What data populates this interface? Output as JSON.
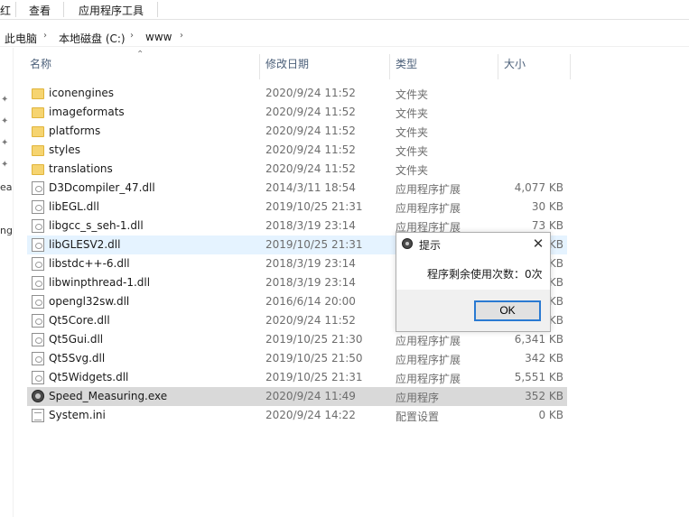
{
  "ribbon": {
    "tab_fragment": "红",
    "tab_view": "查看",
    "tab_app_tools": "应用程序工具"
  },
  "breadcrumb": [
    "此电脑",
    "本地磁盘 (C:)",
    "www"
  ],
  "nav_fragments": {
    "a": "ea",
    "b": "ng"
  },
  "columns": {
    "name": "名称",
    "date": "修改日期",
    "type": "类型",
    "size": "大小"
  },
  "files": [
    {
      "name": "iconengines",
      "date": "2020/9/24 11:52",
      "type": "文件夹",
      "size": "",
      "icon": "folder-icon"
    },
    {
      "name": "imageformats",
      "date": "2020/9/24 11:52",
      "type": "文件夹",
      "size": "",
      "icon": "folder-icon"
    },
    {
      "name": "platforms",
      "date": "2020/9/24 11:52",
      "type": "文件夹",
      "size": "",
      "icon": "folder-icon"
    },
    {
      "name": "styles",
      "date": "2020/9/24 11:52",
      "type": "文件夹",
      "size": "",
      "icon": "folder-icon"
    },
    {
      "name": "translations",
      "date": "2020/9/24 11:52",
      "type": "文件夹",
      "size": "",
      "icon": "folder-icon"
    },
    {
      "name": "D3Dcompiler_47.dll",
      "date": "2014/3/11 18:54",
      "type": "应用程序扩展",
      "size": "4,077 KB",
      "icon": "dll-file-icon"
    },
    {
      "name": "libEGL.dll",
      "date": "2019/10/25 21:31",
      "type": "应用程序扩展",
      "size": "30 KB",
      "icon": "dll-file-icon"
    },
    {
      "name": "libgcc_s_seh-1.dll",
      "date": "2018/3/19 23:14",
      "type": "应用程序扩展",
      "size": "73 KB",
      "icon": "dll-file-icon"
    },
    {
      "name": "libGLESV2.dll",
      "date": "2019/10/25 21:31",
      "type": "",
      "size": "KB",
      "icon": "dll-file-icon"
    },
    {
      "name": "libstdc++-6.dll",
      "date": "2018/3/19 23:14",
      "type": "",
      "size": "KB",
      "icon": "dll-file-icon"
    },
    {
      "name": "libwinpthread-1.dll",
      "date": "2018/3/19 23:14",
      "type": "",
      "size": "KB",
      "icon": "dll-file-icon"
    },
    {
      "name": "opengl32sw.dll",
      "date": "2016/6/14 20:00",
      "type": "",
      "size": "KB",
      "icon": "dll-file-icon"
    },
    {
      "name": "Qt5Core.dll",
      "date": "2020/9/24 11:52",
      "type": "",
      "size": "KB",
      "icon": "dll-file-icon"
    },
    {
      "name": "Qt5Gui.dll",
      "date": "2019/10/25 21:30",
      "type": "应用程序扩展",
      "size": "6,341 KB",
      "icon": "dll-file-icon"
    },
    {
      "name": "Qt5Svg.dll",
      "date": "2019/10/25 21:50",
      "type": "应用程序扩展",
      "size": "342 KB",
      "icon": "dll-file-icon"
    },
    {
      "name": "Qt5Widgets.dll",
      "date": "2019/10/25 21:31",
      "type": "应用程序扩展",
      "size": "5,551 KB",
      "icon": "dll-file-icon"
    },
    {
      "name": "Speed_Measuring.exe",
      "date": "2020/9/24 11:49",
      "type": "应用程序",
      "size": "352 KB",
      "icon": "exe-app-icon"
    },
    {
      "name": "System.ini",
      "date": "2020/9/24 14:22",
      "type": "配置设置",
      "size": "0 KB",
      "icon": "ini-file-icon"
    }
  ],
  "dialog": {
    "title": "提示",
    "message": "程序剩余使用次数：0次",
    "ok_label": "OK",
    "close_glyph": "✕"
  },
  "colors": {
    "hover_row": "#e5f3ff",
    "selected_row": "#d9d9d9",
    "ok_border": "#2a7ad2",
    "folder": "#f6d470"
  }
}
